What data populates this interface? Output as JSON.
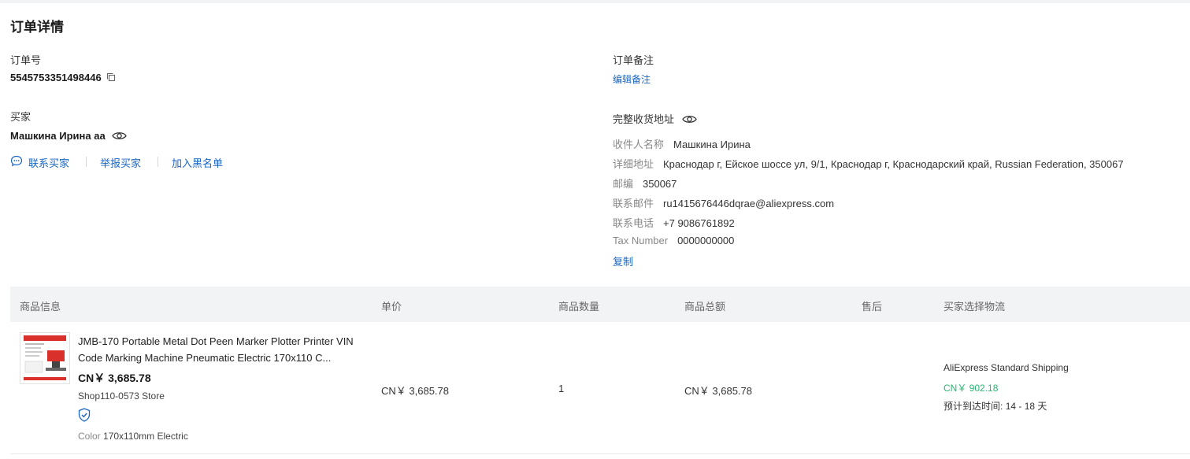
{
  "page": {
    "title": "订单详情"
  },
  "order": {
    "number_label": "订单号",
    "number": "5545753351498446",
    "note_label": "订单备注",
    "edit_note": "编辑备注"
  },
  "buyer": {
    "label": "买家",
    "name": "Машкина Ирина аа",
    "actions": {
      "contact": "联系买家",
      "report": "举报买家",
      "blacklist": "加入黑名单"
    }
  },
  "address": {
    "title": "完整收货地址",
    "fields": [
      {
        "key": "收件人名称",
        "value": "Машкина Ирина"
      },
      {
        "key": "详细地址",
        "value": "Краснодар г, Ейское шоссе ул, 9/1, Краснодар г, Краснодарский край, Russian Federation, 350067"
      },
      {
        "key": "邮编",
        "value": "350067"
      },
      {
        "key": "联系邮件",
        "value": "ru1415676446dqrae@aliexpress.com"
      },
      {
        "key": "联系电话",
        "value": "+7 9086761892"
      },
      {
        "key": "Tax Number",
        "value": "0000000000"
      }
    ],
    "copy": "复制"
  },
  "table": {
    "headers": [
      "商品信息",
      "单价",
      "商品数量",
      "商品总额",
      "售后",
      "买家选择物流"
    ],
    "rows": [
      {
        "title": "JMB-170 Portable Metal Dot Peen Marker Plotter Printer VIN Code Marking Machine Pneumatic Electric 170x110 C...",
        "price_main": "CN￥ 3,685.78",
        "store": "Shop110-0573 Store",
        "sku_key": "Color",
        "sku_value": "170x110mm Electric",
        "unit_price": "CN￥ 3,685.78",
        "quantity": "1",
        "total": "CN￥ 3,685.78",
        "shipping_method": "AliExpress Standard Shipping",
        "shipping_cost": "CN￥ 902.18",
        "delivery_label": "预计到达时间:",
        "delivery_range": "14 - 18 天"
      }
    ]
  },
  "colors": {
    "link": "#1a66c6",
    "green": "#2bb673",
    "header_bg": "#f2f3f5"
  },
  "icons": [
    "copy-icon",
    "eye-icon",
    "chat-icon",
    "shield-check-icon"
  ]
}
